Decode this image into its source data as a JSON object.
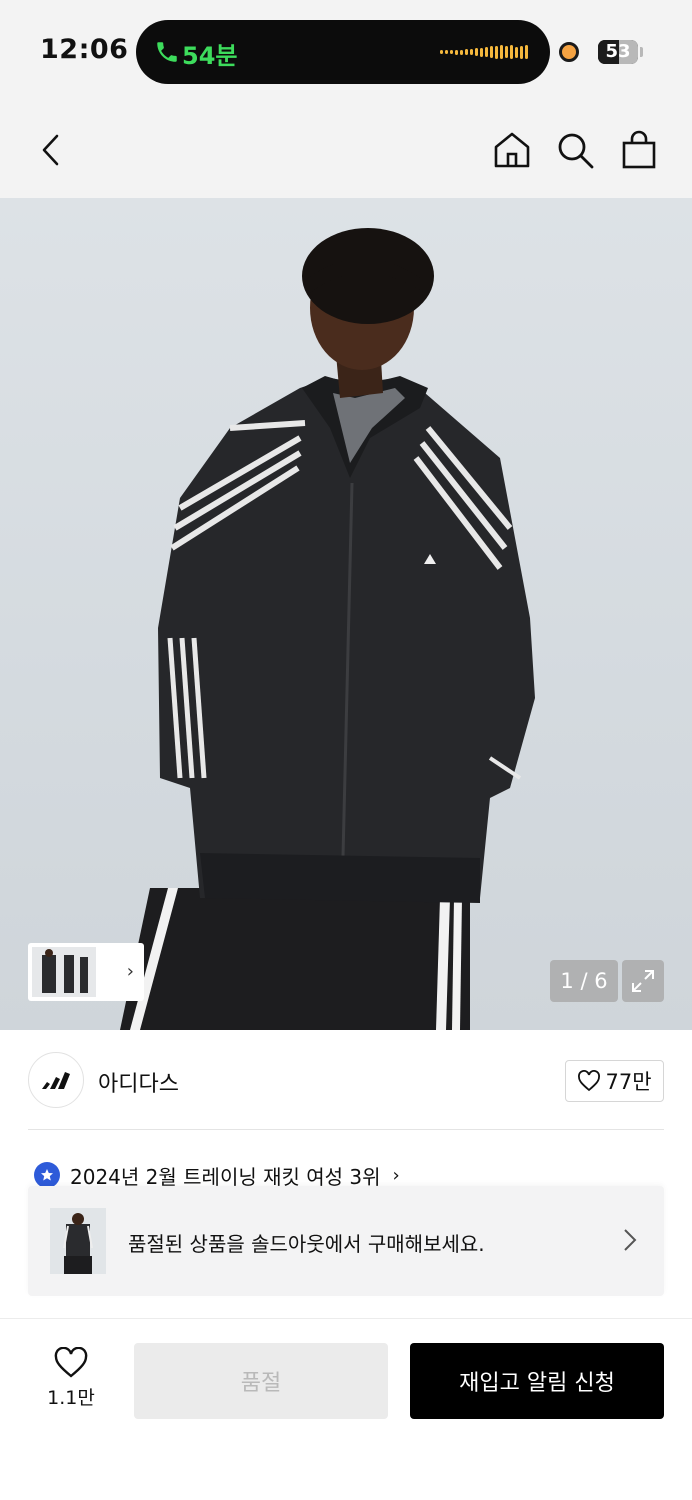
{
  "status_bar": {
    "time": "12:06",
    "call_duration": "54분",
    "battery_level": "53",
    "call_color": "#3ddc5c",
    "recording_dot_color": "#f5a342"
  },
  "nav": {
    "back_icon": "chevron-left-icon",
    "home_icon": "home-icon",
    "search_icon": "search-icon",
    "cart_icon": "shopping-bag-icon"
  },
  "gallery": {
    "counter": "1 / 6",
    "current_index": 1,
    "total": 6,
    "thumbnail_icon": "chevron-right-icon",
    "expand_icon": "expand-icon"
  },
  "brand": {
    "name": "아디다스",
    "likes": "77만"
  },
  "ranking": {
    "text": "2024년 2월 트레이닝 재킷 여성 3위",
    "badge_color": "#2e5bd9"
  },
  "banner": {
    "text": "품절된 상품을 솔드아웃에서 구매해보세요."
  },
  "bottom_bar": {
    "wish_count": "1.1만",
    "soldout_label": "품절",
    "restock_label": "재입고 알림 신청"
  }
}
